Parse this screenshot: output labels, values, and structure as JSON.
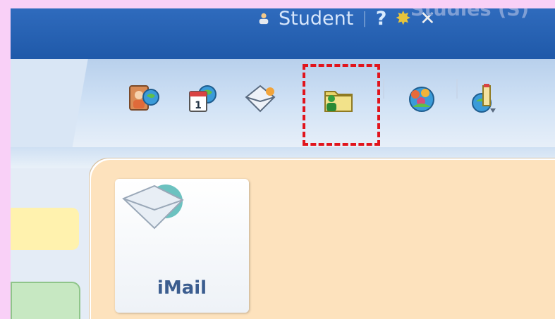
{
  "header": {
    "user_label": "Student",
    "help_label": "?",
    "studies_label": "Studies (S)"
  },
  "toolbar": {
    "icons": [
      "contacts-icon",
      "calendar-icon",
      "mail-icon",
      "user-folder-icon",
      "groups-icon",
      "download-icon"
    ]
  },
  "tiles": {
    "imail_label": "iMail"
  },
  "colors": {
    "header": "#2a66b8",
    "highlight_border": "#e1141c",
    "panel": "#fde2bd"
  }
}
